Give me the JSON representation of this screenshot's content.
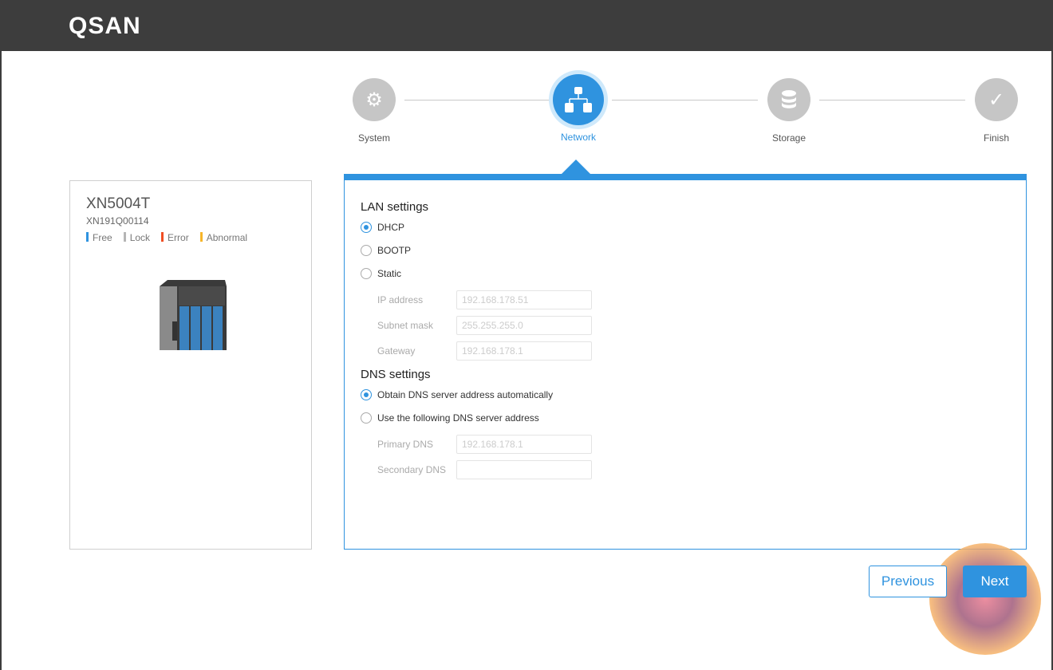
{
  "brand": "QSAN",
  "steps": [
    {
      "label": "System",
      "icon": "gear-icon"
    },
    {
      "label": "Network",
      "icon": "network-icon",
      "active": true
    },
    {
      "label": "Storage",
      "icon": "database-icon"
    },
    {
      "label": "Finish",
      "icon": "check-icon"
    }
  ],
  "device": {
    "model": "XN5004T",
    "serial": "XN191Q00114",
    "legend": [
      {
        "label": "Free",
        "color": "#2f93df"
      },
      {
        "label": "Lock",
        "color": "#b5b5b5"
      },
      {
        "label": "Error",
        "color": "#f04e23"
      },
      {
        "label": "Abnormal",
        "color": "#f7b529"
      }
    ]
  },
  "lan": {
    "title": "LAN settings",
    "options": [
      "DHCP",
      "BOOTP",
      "Static"
    ],
    "selected": "DHCP",
    "fields": [
      {
        "label": "IP address",
        "value": "192.168.178.51"
      },
      {
        "label": "Subnet mask",
        "value": "255.255.255.0"
      },
      {
        "label": "Gateway",
        "value": "192.168.178.1"
      }
    ]
  },
  "dns": {
    "title": "DNS settings",
    "options": [
      "Obtain DNS server address automatically",
      "Use the following DNS server address"
    ],
    "selected": "Obtain DNS server address automatically",
    "fields": [
      {
        "label": "Primary DNS",
        "value": "192.168.178.1"
      },
      {
        "label": "Secondary DNS",
        "value": ""
      }
    ]
  },
  "buttons": {
    "previous": "Previous",
    "next": "Next"
  }
}
